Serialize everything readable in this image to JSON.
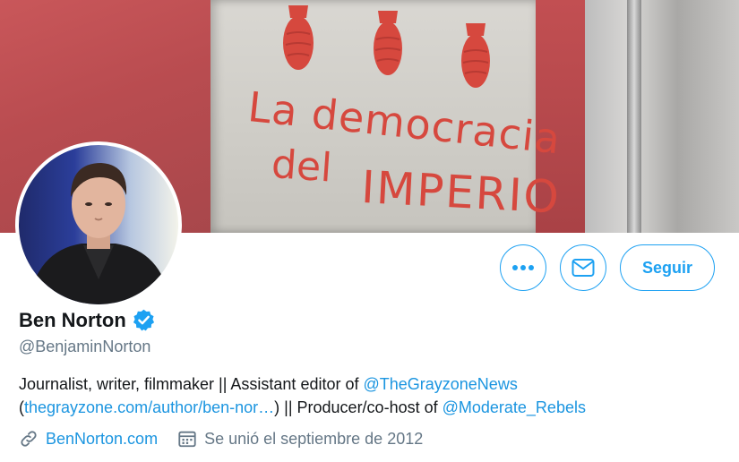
{
  "profile": {
    "display_name": "Ben Norton",
    "handle": "@BenjaminNorton",
    "verified": true,
    "bio": {
      "part1": "Journalist, writer, filmmaker || Assistant editor of ",
      "mention1": "@TheGrayzoneNews",
      "paren_open": "(",
      "link1": "thegrayzone.com/author/ben-nor…",
      "part2": ") || Producer/co-host of ",
      "mention2": "@Moderate_Rebels"
    },
    "website": "BenNorton.com",
    "joined": "Se unió el septiembre de 2012"
  },
  "banner": {
    "graffiti_line1": "La democracia",
    "graffiti_line2": "del",
    "graffiti_line3": "IMPERIO"
  },
  "actions": {
    "more_icon": "more-horizontal-icon",
    "message_icon": "envelope-icon",
    "follow_label": "Seguir"
  },
  "colors": {
    "accent": "#1da1f2",
    "link": "#1b95e0",
    "secondary_text": "#657786",
    "primary_text": "#14171a"
  }
}
